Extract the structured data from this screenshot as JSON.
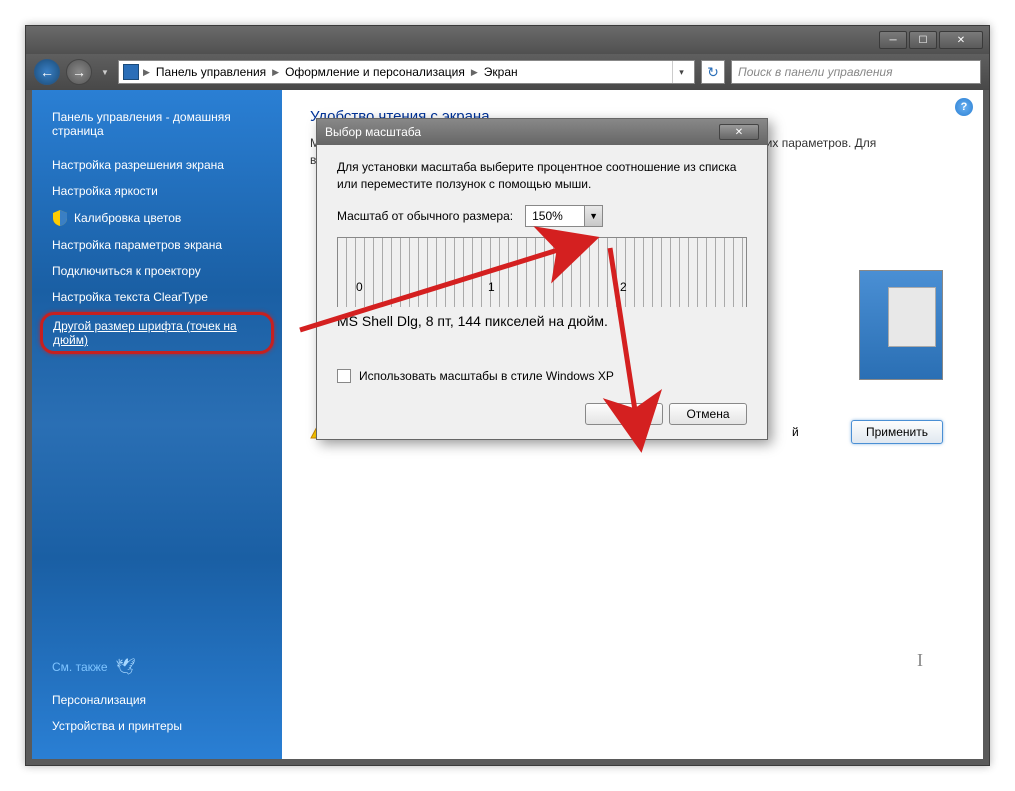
{
  "breadcrumb": {
    "items": [
      "Панель управления",
      "Оформление и персонализация",
      "Экран"
    ]
  },
  "search": {
    "placeholder": "Поиск в панели управления"
  },
  "sidebar": {
    "home": "Панель управления - домашняя страница",
    "items": [
      "Настройка разрешения экрана",
      "Настройка яркости",
      "Калибровка цветов",
      "Настройка параметров экрана",
      "Подключиться к проектору",
      "Настройка текста ClearType",
      "Другой размер шрифта (точек на дюйм)"
    ],
    "see_also": "См. также",
    "bottom": [
      "Персонализация",
      "Устройства и принтеры"
    ]
  },
  "content": {
    "heading": "Удобство чтения с экрана",
    "p1_prefix": "Мо",
    "p1_suffix": "тих параметров. Для",
    "p2_prefix": "вре",
    "p3_suffix": "й",
    "apply": "Применить"
  },
  "dialog": {
    "title": "Выбор масштаба",
    "intro": "Для установки масштаба выберите процентное соотношение из списка или переместите ползунок с помощью мыши.",
    "scale_label": "Масштаб от обычного размера:",
    "scale_value": "150%",
    "ruler_labels": [
      "0",
      "1",
      "2"
    ],
    "sample": "MS Shell Dlg, 8 пт, 144 пикселей на дюйм.",
    "xp_check": "Использовать масштабы в стиле Windows XP",
    "ok": "ОК",
    "cancel": "Отмена"
  }
}
